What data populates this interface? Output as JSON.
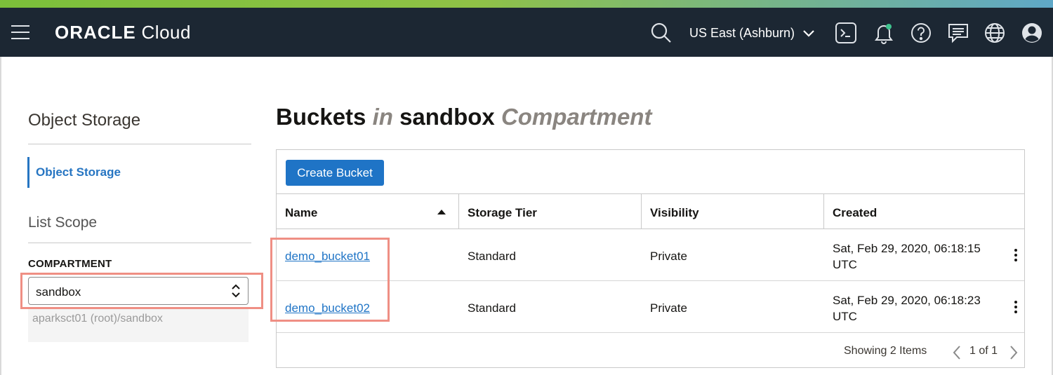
{
  "header": {
    "brand_bold": "ORACLE",
    "brand_light": "Cloud",
    "region": "US East (Ashburn)",
    "icons": [
      "menu-icon",
      "search-icon",
      "chevron-down-icon",
      "cloud-shell-icon",
      "bell-icon",
      "help-icon",
      "chat-icon",
      "globe-icon",
      "user-icon"
    ],
    "accent_color": "#1c2733"
  },
  "sidebar": {
    "title": "Object Storage",
    "items": [
      {
        "label": "Object Storage",
        "active": true
      }
    ],
    "scope_title": "List Scope",
    "compartment_label": "COMPARTMENT",
    "compartment_value": "sandbox",
    "compartment_path": "aparksct01 (root)/sandbox"
  },
  "main": {
    "title_prefix": "Buckets",
    "title_in": "in",
    "title_compartment": "sandbox",
    "title_suffix": "Compartment",
    "create_button": "Create Bucket",
    "columns": [
      "Name",
      "Storage Tier",
      "Visibility",
      "Created"
    ],
    "rows": [
      {
        "name": "demo_bucket01",
        "tier": "Standard",
        "visibility": "Private",
        "created_line1": "Sat, Feb 29, 2020, 06:18:15",
        "created_line2": "UTC"
      },
      {
        "name": "demo_bucket02",
        "tier": "Standard",
        "visibility": "Private",
        "created_line1": "Sat, Feb 29, 2020, 06:18:23",
        "created_line2": "UTC"
      }
    ],
    "footer_count": "Showing 2 Items",
    "pager": "1 of 1",
    "link_color": "#1f74c6",
    "button_color": "#1f74c6",
    "highlight_color": "#ef8f84"
  }
}
